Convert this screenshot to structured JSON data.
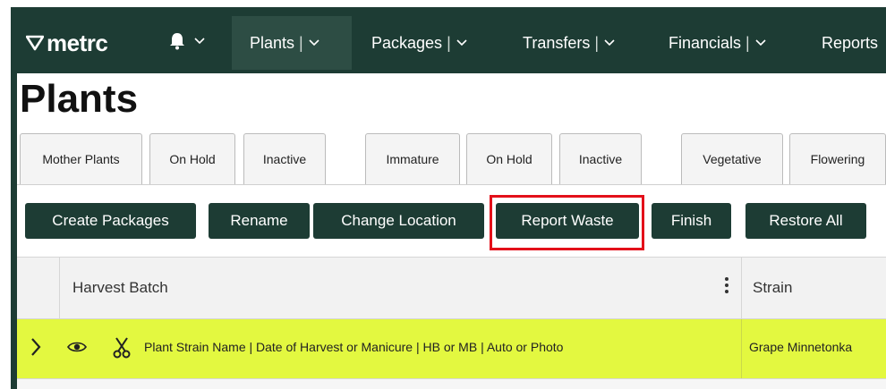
{
  "app": {
    "logo_text": "metrc"
  },
  "nav": {
    "items": [
      {
        "label": "Plants",
        "sep": "|",
        "active": true
      },
      {
        "label": "Packages",
        "sep": "|",
        "active": false
      },
      {
        "label": "Transfers",
        "sep": "|",
        "active": false
      },
      {
        "label": "Financials",
        "sep": "|",
        "active": false
      },
      {
        "label": "Reports",
        "sep": "",
        "active": false
      }
    ]
  },
  "page": {
    "title": "Plants"
  },
  "tabs": [
    "Mother Plants",
    "On Hold",
    "Inactive",
    "Immature",
    "On Hold",
    "Inactive",
    "Vegetative",
    "Flowering"
  ],
  "actions": {
    "create_packages": "Create Packages",
    "rename": "Rename",
    "change_location": "Change Location",
    "report_waste": "Report Waste",
    "finish": "Finish",
    "restore_all": "Restore All"
  },
  "grid": {
    "columns": {
      "harvest_batch": "Harvest Batch",
      "strain": "Strain"
    },
    "rows": [
      {
        "harvest_batch": "Plant Strain Name | Date of Harvest or Manicure | HB or MB | Auto or Photo",
        "strain": "Grape Minnetonka"
      }
    ]
  },
  "colors": {
    "nav_bg": "#1d3c34",
    "button_bg": "#1d3c34",
    "highlight_border": "#e3101a",
    "row_highlight": "#e3f840"
  },
  "icons": [
    "logo-mark-icon",
    "bell-icon",
    "chevron-down-icon",
    "kebab-menu-icon",
    "chevron-right-icon",
    "eye-icon",
    "scissors-icon"
  ]
}
